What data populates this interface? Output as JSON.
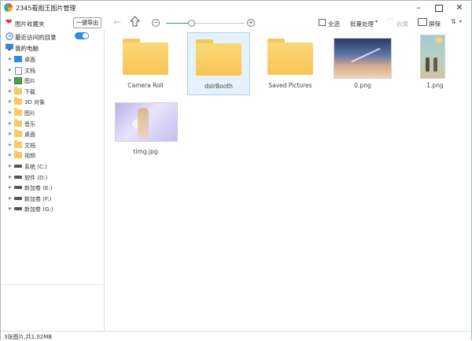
{
  "window": {
    "title": "2345看图王图片管理",
    "controls": {
      "minimize": "–",
      "close": "✕"
    }
  },
  "toolbar": {
    "favorites_label": "图片收藏夹",
    "export_label": "一键导出",
    "back_icon": "←",
    "zoom_out": "−",
    "zoom_in": "+",
    "zoom_level": 0.32,
    "select_all_label": "全选",
    "batch_label": "批量处理",
    "caret": "▾",
    "collect_label": "收藏",
    "screen_label": "屏保",
    "sort_icon": "⇅"
  },
  "sidebar": {
    "recent_label": "最近访问的目录",
    "recent_enabled": true,
    "computer_label": "我的电脑",
    "items": [
      {
        "label": "桌面",
        "icon": "desktop"
      },
      {
        "label": "文档",
        "icon": "doc"
      },
      {
        "label": "图片",
        "icon": "pic"
      },
      {
        "label": "下载",
        "icon": "folder"
      },
      {
        "label": "3D 对象",
        "icon": "folder"
      },
      {
        "label": "图片",
        "icon": "folder"
      },
      {
        "label": "音乐",
        "icon": "folder"
      },
      {
        "label": "桌面",
        "icon": "folder"
      },
      {
        "label": "文档",
        "icon": "folder"
      },
      {
        "label": "视频",
        "icon": "folder"
      },
      {
        "label": "系统 (C:)",
        "icon": "drive"
      },
      {
        "label": "软件 (D:)",
        "icon": "drive"
      },
      {
        "label": "新加卷 (E:)",
        "icon": "drive"
      },
      {
        "label": "新加卷 (F:)",
        "icon": "drive"
      },
      {
        "label": "新加卷 (G:)",
        "icon": "drive"
      }
    ]
  },
  "files": [
    {
      "name": "Camera Roll",
      "kind": "folder",
      "selected": false
    },
    {
      "name": "dslrBooth",
      "kind": "folder",
      "selected": true
    },
    {
      "name": "Saved Pictures",
      "kind": "folder",
      "selected": false
    },
    {
      "name": "0.png",
      "kind": "image-sky",
      "selected": false
    },
    {
      "name": "1.png",
      "kind": "image-tall",
      "selected": false
    },
    {
      "name": "timg.jpg",
      "kind": "image-anime",
      "selected": false
    }
  ],
  "status": {
    "text": "3张图片,共1.02MB"
  },
  "colors": {
    "accent": "#2f8ae5",
    "folder": "#f8c457",
    "selection": "#e5f1fb"
  }
}
